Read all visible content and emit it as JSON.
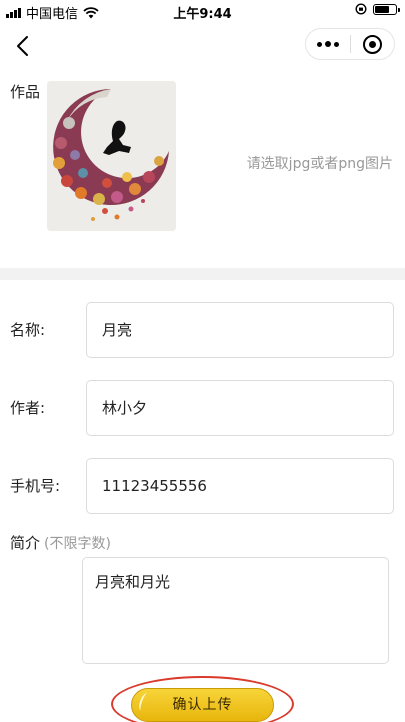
{
  "status_bar": {
    "carrier": "中国电信",
    "time": "上午9:44"
  },
  "nav": {
    "back_icon": "chevron-left-icon",
    "more_icon": "more-dots-icon",
    "close_icon": "target-close-icon"
  },
  "artwork": {
    "label": "作品",
    "pick_hint": "请选取jpg或者png图片"
  },
  "form": {
    "name_label": "名称:",
    "name_value": "月亮",
    "author_label": "作者:",
    "author_value": "林小夕",
    "phone_label": "手机号:",
    "phone_value": "11123455556",
    "intro_label": "简介",
    "intro_hint": "(不限字数)",
    "intro_value": "月亮和月光"
  },
  "submit": {
    "label": "确认上传"
  },
  "colors": {
    "accent": "#f2c41c",
    "annotation": "#d93a2b",
    "hint_text": "#999999",
    "section_band": "#f2f2f2"
  }
}
